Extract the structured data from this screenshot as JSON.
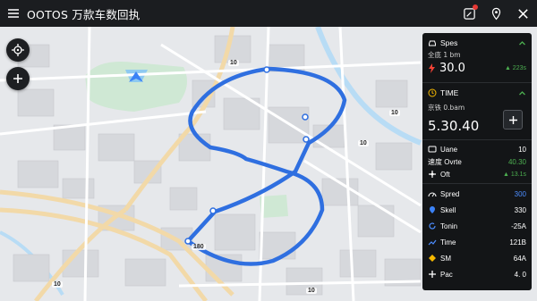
{
  "app": {
    "title": "OOTOS 万款车数回执"
  },
  "map": {
    "labels": {
      "route_a": "10",
      "route_b": "10",
      "route_c": "10",
      "route_d": "10",
      "route_e": "10",
      "start": "180"
    },
    "colors": {
      "route": "#2f6fe0",
      "park": "#cfe8d4",
      "water": "#b8dcf5"
    }
  },
  "panel": {
    "speed_section": {
      "title": "Spes",
      "sub_label": "全底 1 bm",
      "value": "30.0",
      "trend": "▲ 223s",
      "icon": "car-icon"
    },
    "time_section": {
      "title": "TIME",
      "sub_label": "京铁 0.bam",
      "value": "5.30.40",
      "icon": "clock-icon"
    },
    "stats_a": [
      {
        "icon": "device-icon",
        "label": "Uane",
        "value": "10"
      },
      {
        "icon": "none",
        "label": "速度 Ovrte",
        "value": "40.30"
      },
      {
        "icon": "compass-icon",
        "label": "Oft",
        "value": "▲ 13.1s"
      }
    ],
    "stats_b": [
      {
        "icon": "speed-icon",
        "label": "Spred",
        "value": "300",
        "value_color": "#4c8dff"
      },
      {
        "icon": "pin-icon",
        "label": "Skell",
        "value": "330"
      },
      {
        "icon": "rotate-icon",
        "label": "Tonin",
        "value": "-25A"
      },
      {
        "icon": "trend-icon",
        "label": "Time",
        "value": "121B"
      },
      {
        "icon": "diamond-icon",
        "label": "SM",
        "value": "64A"
      },
      {
        "icon": "plus-icon",
        "label": "Pac",
        "value": "4. 0"
      }
    ],
    "accent_green": "#4caf50",
    "accent_red": "#f44336"
  }
}
